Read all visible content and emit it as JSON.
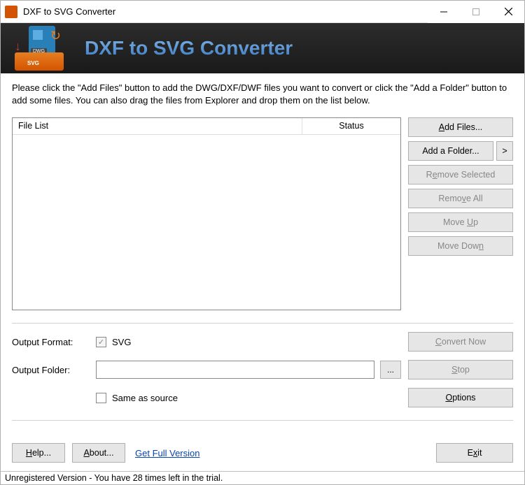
{
  "titlebar": {
    "title": "DXF to SVG Converter",
    "icon_text": "DXF\nSVG"
  },
  "banner": {
    "title": "DXF to SVG Converter",
    "icon_label_top": "DWG",
    "icon_label_bottom": "SVG"
  },
  "instructions": "Please click the \"Add Files\" button to add the DWG/DXF/DWF files you want to convert or click the \"Add a Folder\" button to add some files. You can also drag the files from Explorer and drop them on the list below.",
  "filelist": {
    "col_file": "File List",
    "col_status": "Status"
  },
  "buttons": {
    "add_files_pre": "",
    "add_files_u": "A",
    "add_files_post": "dd Files...",
    "add_folder": "Add a Folder...",
    "chevron": ">",
    "remove_selected_pre": "R",
    "remove_selected_u": "e",
    "remove_selected_post": "move Selected",
    "remove_all_pre": "Remo",
    "remove_all_u": "v",
    "remove_all_post": "e All",
    "move_up_pre": "Move ",
    "move_up_u": "U",
    "move_up_post": "p",
    "move_down_pre": "Move Dow",
    "move_down_u": "n",
    "move_down_post": "",
    "convert_u": "C",
    "convert_post": "onvert Now",
    "stop_u": "S",
    "stop_post": "top",
    "options_u": "O",
    "options_post": "ptions",
    "help_u": "H",
    "help_post": "elp...",
    "about_u": "A",
    "about_post": "bout...",
    "exit_pre": "E",
    "exit_u": "x",
    "exit_post": "it",
    "browse": "..."
  },
  "form": {
    "output_format_label": "Output Format:",
    "svg_label": "SVG",
    "output_folder_label": "Output Folder:",
    "output_folder_value": "",
    "same_as_source": "Same as source"
  },
  "link": {
    "get_full": "Get Full Version"
  },
  "statusbar": "Unregistered Version - You have 28 times left in the trial."
}
